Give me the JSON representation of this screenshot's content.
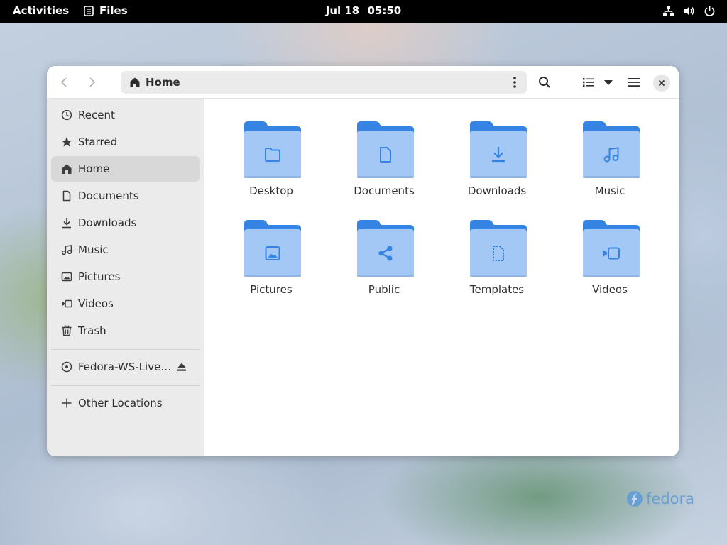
{
  "topbar": {
    "activities": "Activities",
    "app_name": "Files",
    "date": "Jul 18",
    "time": "05:50",
    "tray_icons": [
      "network-icon",
      "volume-icon",
      "power-icon"
    ]
  },
  "window": {
    "path_label": "Home",
    "header_buttons": [
      "back",
      "forward",
      "path-menu",
      "search",
      "list-view",
      "view-options",
      "main-menu",
      "close"
    ]
  },
  "sidebar": {
    "items": [
      {
        "label": "Recent",
        "icon": "clock-icon"
      },
      {
        "label": "Starred",
        "icon": "star-icon"
      },
      {
        "label": "Home",
        "icon": "home-icon",
        "active": true
      },
      {
        "label": "Documents",
        "icon": "document-icon"
      },
      {
        "label": "Downloads",
        "icon": "download-icon"
      },
      {
        "label": "Music",
        "icon": "music-icon"
      },
      {
        "label": "Pictures",
        "icon": "picture-icon"
      },
      {
        "label": "Videos",
        "icon": "video-icon"
      },
      {
        "label": "Trash",
        "icon": "trash-icon"
      }
    ],
    "devices": [
      {
        "label": "Fedora-WS-Live…",
        "icon": "disc-icon",
        "eject_icon": "eject-icon"
      }
    ],
    "other": [
      {
        "label": "Other Locations",
        "icon": "plus-icon"
      }
    ]
  },
  "files": [
    {
      "name": "Desktop",
      "emblem": "folder-emblem-icon"
    },
    {
      "name": "Documents",
      "emblem": "document-emblem-icon"
    },
    {
      "name": "Downloads",
      "emblem": "download-emblem-icon"
    },
    {
      "name": "Music",
      "emblem": "music-emblem-icon"
    },
    {
      "name": "Pictures",
      "emblem": "picture-emblem-icon"
    },
    {
      "name": "Public",
      "emblem": "share-emblem-icon"
    },
    {
      "name": "Templates",
      "emblem": "template-emblem-icon"
    },
    {
      "name": "Videos",
      "emblem": "video-emblem-icon"
    }
  ],
  "colors": {
    "folder_back": "#3584e4",
    "folder_front": "#a4c8f5",
    "emblem": "#3584e4",
    "wallpaper_logo": "#5e9ad6"
  },
  "wallpaper": {
    "logo_text": "fedora"
  }
}
